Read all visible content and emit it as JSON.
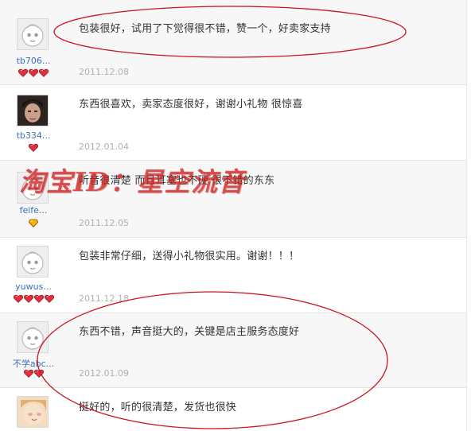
{
  "reviews": [
    {
      "username": "tb706...",
      "comment": "包装很好，试用了下觉得很不错，赞一个，好卖家支持",
      "date": "2011.12.08",
      "avatar": "default-avatar",
      "badge_count": 3,
      "badge_type": "heart",
      "badge_color": "#e03040"
    },
    {
      "username": "tb334...",
      "comment": "东西很喜欢，卖家态度很好，谢谢小礼物 很惊喜",
      "date": "2012.01.04",
      "avatar": "photo-avatar",
      "badge_count": 1,
      "badge_type": "heart",
      "badge_color": "#e03040"
    },
    {
      "username": "feife...",
      "comment": "听音很清楚 而且耳塞也不硬 很不错的东东",
      "date": "2011.12.05",
      "avatar": "default-avatar",
      "badge_count": 1,
      "badge_type": "diamond",
      "badge_color": "#f0b800"
    },
    {
      "username": "yuwus...",
      "comment": "包装非常仔细，送得小礼物很实用。谢谢！！！",
      "date": "2011.12.18",
      "avatar": "default-avatar",
      "badge_count": 4,
      "badge_type": "heart",
      "badge_color": "#e03040"
    },
    {
      "username": "不学abc...",
      "comment": "东西不错，声音挺大的，关键是店主服务态度好",
      "date": "2012.01.09",
      "avatar": "default-avatar",
      "badge_count": 2,
      "badge_type": "heart",
      "badge_color": "#e03040"
    },
    {
      "username": "",
      "comment": "挺好的，听的很清楚，发货也很快",
      "date": "",
      "avatar": "photo-avatar-2",
      "badge_count": 0,
      "badge_type": "heart",
      "badge_color": "#e03040"
    }
  ],
  "watermark": "淘宝ID：星空流音",
  "annotation_color": "#c8141e"
}
